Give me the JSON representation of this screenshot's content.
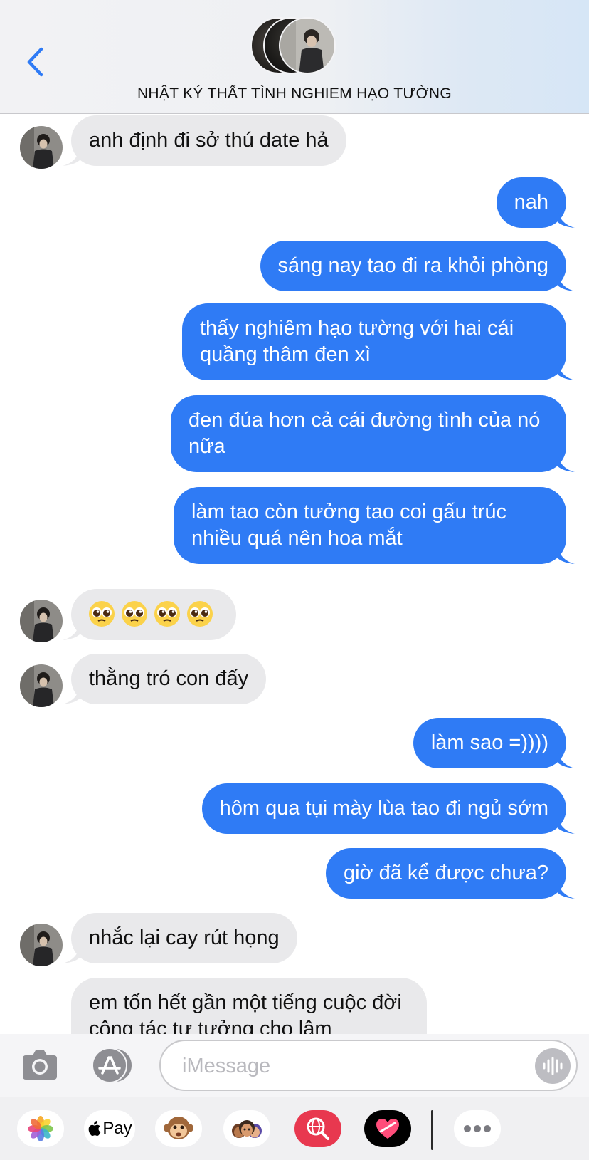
{
  "header": {
    "title": "NHẬT KÝ THẤT TÌNH NGHIEM HẠO TƯỜNG"
  },
  "messages": [
    {
      "dir": "in",
      "text": "anh định đi sở thú date hả"
    },
    {
      "dir": "out",
      "text": "nah"
    },
    {
      "dir": "out",
      "text": "sáng nay tao đi ra khỏi phòng"
    },
    {
      "dir": "out",
      "text": "thấy nghiêm hạo tường với hai cái quầng thâm đen xì"
    },
    {
      "dir": "out",
      "text": "đen đúa hơn cả cái đường tình của nó nữa"
    },
    {
      "dir": "out",
      "text": "làm tao còn tưởng tao coi gấu trúc nhiều quá nên hoa mắt"
    },
    {
      "dir": "in",
      "text": "🥺🥺🥺🥺"
    },
    {
      "dir": "in",
      "text": "thằng tró con đấy"
    },
    {
      "dir": "out",
      "text": "làm sao =))))"
    },
    {
      "dir": "out",
      "text": "hôm qua tụi mày lùa tao đi ngủ sớm"
    },
    {
      "dir": "out",
      "text": "giờ đã kể được chưa?"
    },
    {
      "dir": "in",
      "text": "nhắc lại cay rút họng"
    },
    {
      "dir": "in",
      "text": "em tốn hết gần một tiếng cuộc đời công tác tư tưởng cho lâm"
    }
  ],
  "input": {
    "placeholder": "iMessage",
    "value": ""
  },
  "drawer": {
    "apple_pay_label": "Pay",
    "apps": [
      "photos-icon",
      "apple-pay-icon",
      "memoji-monkey-icon",
      "memoji-stickers-icon",
      "web-search-icon",
      "digital-touch-icon",
      "more-icon"
    ]
  },
  "colors": {
    "outgoing_bubble": "#2f7bf5",
    "incoming_bubble": "#e9e9eb",
    "accent": "#2f7bf5"
  }
}
